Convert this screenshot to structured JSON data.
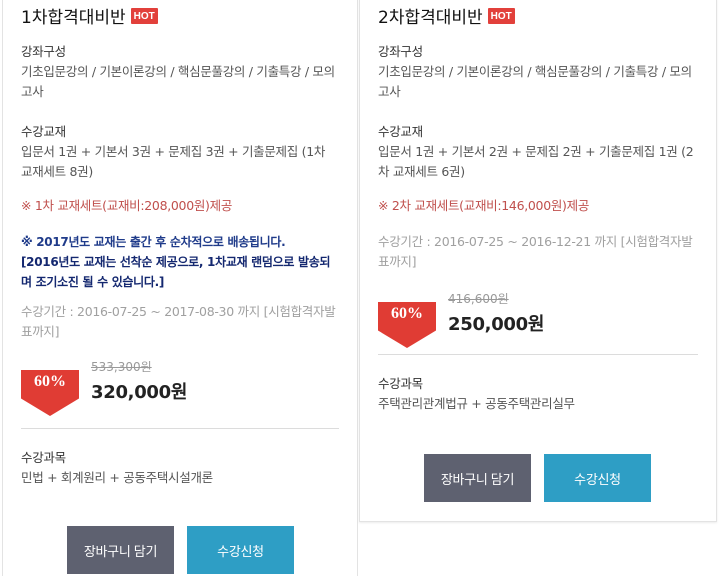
{
  "cards": [
    {
      "title": "1차합격대비반",
      "badge": "HOT",
      "course_label": "강좌구성",
      "course_text": "기초입문강의 / 기본이론강의 / 핵심문풀강의 / 기출특강 / 모의고사",
      "textbook_label": "수강교재",
      "textbook_text": "입문서 1권 + 기본서 3권 + 문제집 3권 + 기출문제집 (1차 교재세트 8권)",
      "textbook_note": "※ 1차 교재세트(교재비:208,000원)제공",
      "notice_line1": "※ 2017년도 교재는 출간 후 순차적으로 배송됩니다.",
      "notice_line2": "[2016년도 교재는 선착순 제공으로, 1차교재 랜덤으로 발송되며 조기소진 될 수 있습니다.]",
      "period": "수강기간 : 2016-07-25 ~ 2017-08-30 까지 [시험합격자발표까지]",
      "discount": "60%",
      "original_price": "533,300원",
      "sale_price": "320,000원",
      "subjects_label": "수강과목",
      "subjects_text": "민법 + 회계원리 + 공동주택시설개론",
      "cart_button": "장바구니 담기",
      "apply_button": "수강신청"
    },
    {
      "title": "2차합격대비반",
      "badge": "HOT",
      "course_label": "강좌구성",
      "course_text": "기초입문강의 / 기본이론강의 / 핵심문풀강의 / 기출특강 / 모의고사",
      "textbook_label": "수강교재",
      "textbook_text": "입문서 1권 + 기본서 2권 + 문제집 2권 + 기출문제집 1권 (2차 교재세트 6권)",
      "textbook_note": "※ 2차 교재세트(교재비:146,000원)제공",
      "period": "수강기간 : 2016-07-25 ~ 2016-12-21 까지 [시험합격자발표까지]",
      "discount": "60%",
      "original_price": "416,600원",
      "sale_price": "250,000원",
      "subjects_label": "수강과목",
      "subjects_text": "주택관리관계법규 + 공동주택관리실무",
      "cart_button": "장바구니 담기",
      "apply_button": "수강신청"
    }
  ],
  "colors": {
    "hot_badge": "#e2403b",
    "discount_badge": "#e03c34",
    "note_red": "#c0504d",
    "notice_blue": "#1f3b8a",
    "cart_button": "#5e6170",
    "apply_button": "#2e9ec5"
  },
  "icons": {
    "discount_badge": "down-arrow-tag"
  }
}
